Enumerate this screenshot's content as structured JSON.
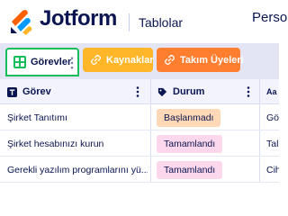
{
  "header": {
    "brand": "Jotform",
    "section": "Tablolar",
    "person_label": "Perso"
  },
  "tabs": [
    {
      "label": "Görevler",
      "icon": "grid-icon",
      "active": true
    },
    {
      "label": "Kaynaklar",
      "icon": "link-icon",
      "color": "#ffb629"
    },
    {
      "label": "Takım Üyeleri",
      "icon": "link-icon",
      "color": "#ff7e2f"
    }
  ],
  "table": {
    "columns": [
      {
        "label": "Görev",
        "icon": "text-type-icon"
      },
      {
        "label": "Durum",
        "icon": "tag-icon"
      },
      {
        "label": "Aa",
        "icon": "text-type-icon"
      }
    ],
    "rows": [
      {
        "task": "Şirket Tanıtımı",
        "status": "Başlanmadı",
        "status_color": "#ffd9b7",
        "third": "Gö"
      },
      {
        "task": "Şirket hesabınızı kurun",
        "status": "Tamamlandı",
        "status_color": "#fdd7ec",
        "third": "Tal"
      },
      {
        "task": "Gerekli yazılım programlarını yü...",
        "status": "Tamamlandı",
        "status_color": "#fdd7ec",
        "third": "Cih"
      }
    ]
  }
}
